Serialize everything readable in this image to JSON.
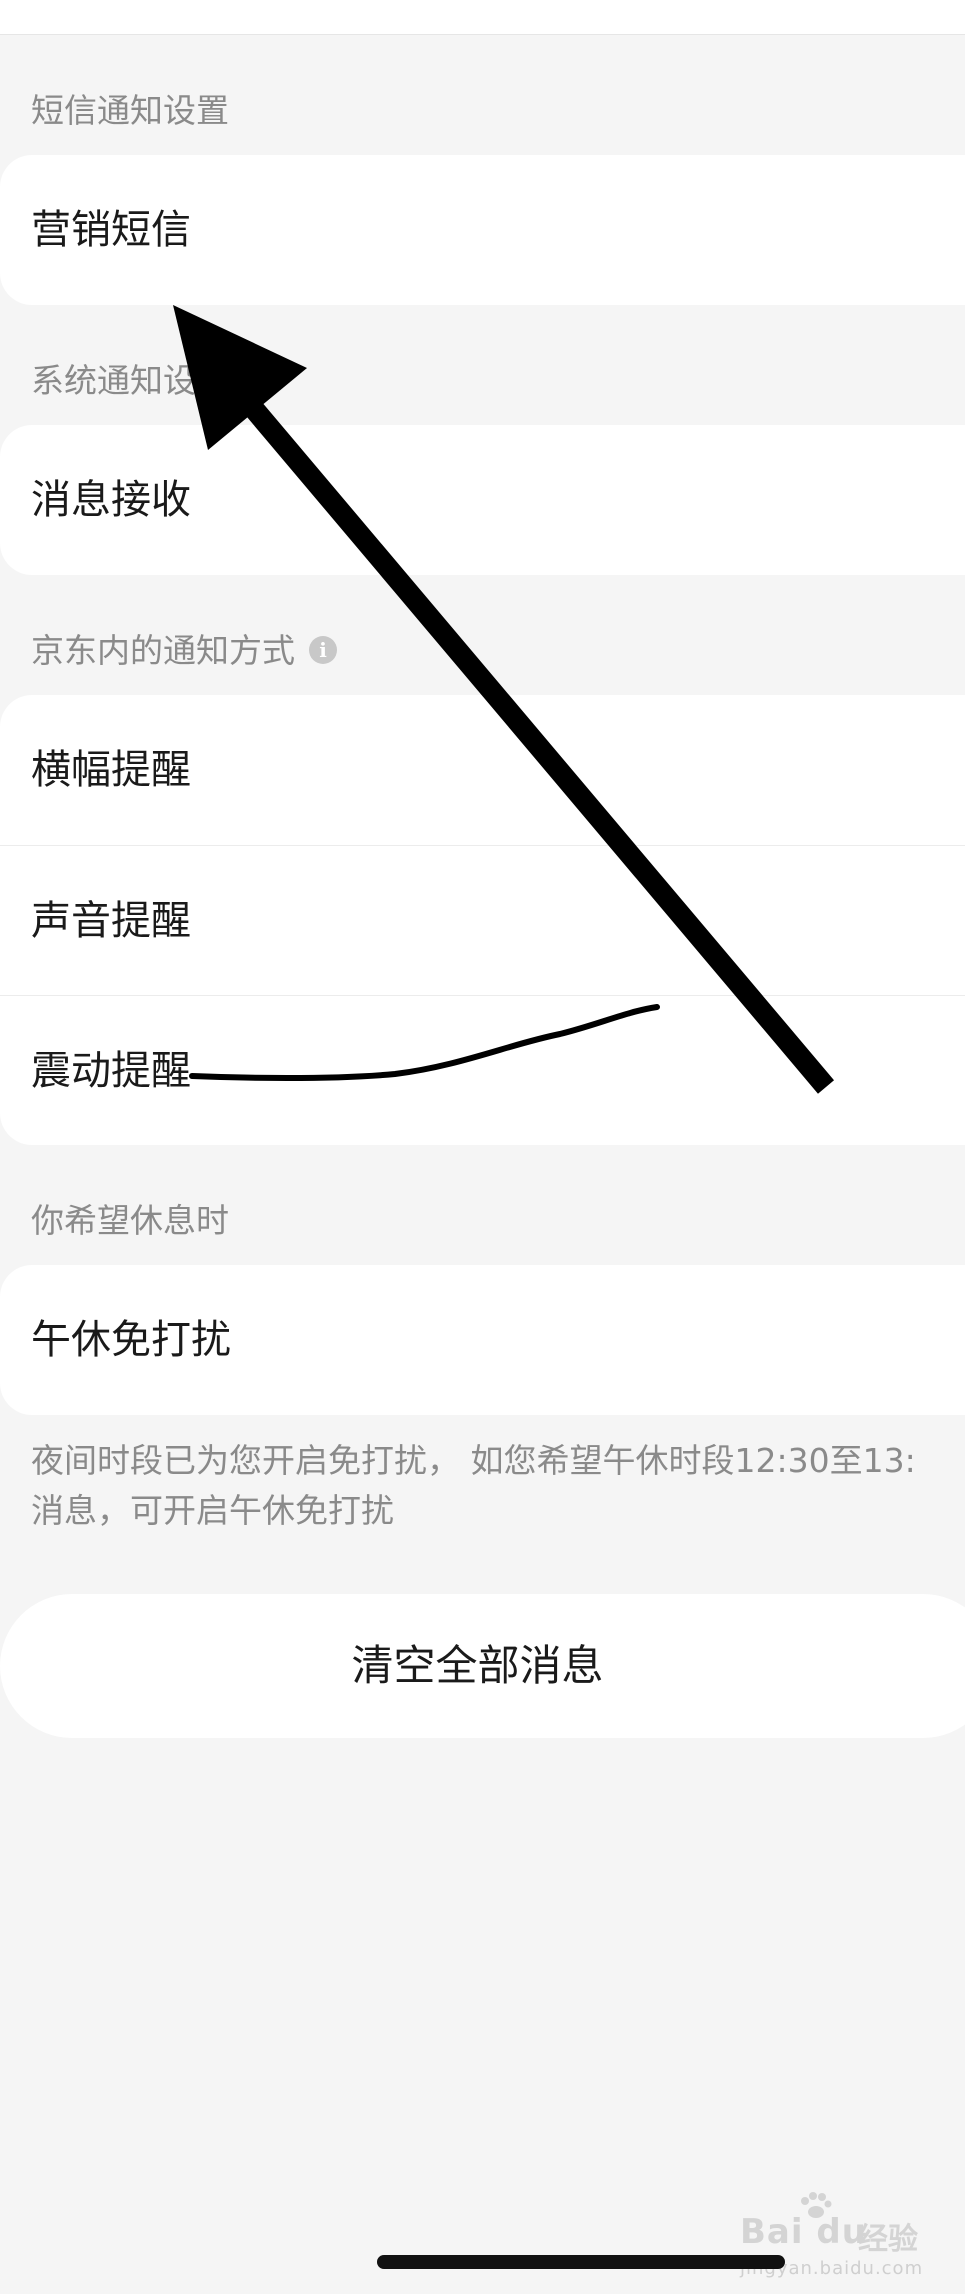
{
  "sections": {
    "sms": {
      "header": "短信通知设置",
      "items": [
        "营销短信"
      ]
    },
    "system": {
      "header": "系统通知设",
      "items": [
        "消息接收"
      ]
    },
    "in_app": {
      "header": "京东内的通知方式",
      "items": [
        "横幅提醒",
        "声音提醒",
        "震动提醒"
      ]
    },
    "rest": {
      "header": "你希望休息时",
      "items": [
        "午休免打扰"
      ]
    }
  },
  "hint": {
    "line1": "夜间时段已为您开启免打扰， 如您希望午休时段12:30至13:",
    "line2": "消息，可开启午休免打扰"
  },
  "clear_button": "清空全部消息",
  "watermark": {
    "logo": "Bai du",
    "cn": "经验",
    "url": "jingyan.baidu.com"
  },
  "icons": {
    "info": "info-icon",
    "arrow": "annotation-arrow",
    "scribble": "annotation-underline"
  },
  "colors": {
    "background": "#f5f5f5",
    "card": "#ffffff",
    "secondary_text": "#8a8a8a",
    "annotation": "#000000"
  }
}
